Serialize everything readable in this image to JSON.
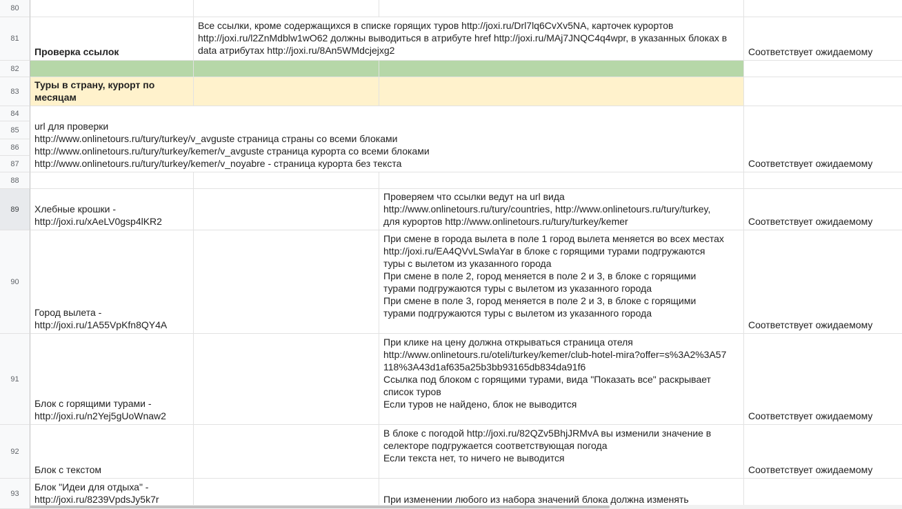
{
  "rows": [
    {
      "n": "80"
    },
    {
      "n": "81"
    },
    {
      "n": "82"
    },
    {
      "n": "83"
    },
    {
      "n": "84"
    },
    {
      "n": "85"
    },
    {
      "n": "86"
    },
    {
      "n": "87"
    },
    {
      "n": "88"
    },
    {
      "n": "89"
    },
    {
      "n": "90"
    },
    {
      "n": "91"
    },
    {
      "n": "92"
    },
    {
      "n": "93"
    }
  ],
  "r81": {
    "a": "Проверка ссылок",
    "b": "Все ссылки, кроме содержащихся в списке горящих туров http://joxi.ru/Drl7lq6CvXv5NA, карточек курортов http://joxi.ru/l2ZnMdblw1wO62 должны выводиться в атрибуте href http://joxi.ru/MAj7JNQC4q4wpr, в указанных блоках в data атрибутах http://joxi.ru/8An5WMdcjejxg2",
    "d": "Соответствует ожидаемому"
  },
  "r83": {
    "a": "Туры в страну, курорт по месяцам"
  },
  "r84_87": {
    "a": "url для проверки\nhttp://www.onlinetours.ru/tury/turkey/v_avguste страница страны со всеми блоками\nhttp://www.onlinetours.ru/tury/turkey/kemer/v_avguste страница курорта со всеми блоками\nhttp://www.onlinetours.ru/tury/turkey/kemer/v_noyabre - страница курорта без текста",
    "d": "Соответствует ожидаемому"
  },
  "r89": {
    "a": "Хлебные крошки -\nhttp://joxi.ru/xAeLV0gsp4lKR2",
    "c": "Проверяем что ссылки ведут на url вида\nhttp://www.onlinetours.ru/tury/countries, http://www.onlinetours.ru/tury/turkey,\nдля курортов http://www.onlinetours.ru/tury/turkey/kemer",
    "d": "Соответствует ожидаемому"
  },
  "r90": {
    "a": "Город вылета -\nhttp://joxi.ru/1A55VpKfn8QY4A",
    "c": "При смене в города вылета в поле 1 город вылета меняется во всех местах\nhttp://joxi.ru/EA4QVvLSwlaYar в блоке с горящими турами подгружаются\nтуры с вылетом из указанного города\nПри смене в поле 2, город меняется в поле 2 и 3, в блоке с горящими\nтурами подгружаются туры с вылетом из указанного города\nПри смене в поле 3, город меняется в поле 2 и 3, в блоке с горящими\nтурами подгружаются туры с вылетом из указанного города",
    "d": "Соответствует ожидаемому"
  },
  "r91": {
    "a": "Блок с горящими турами -\nhttp://joxi.ru/n2Yej5gUoWnaw2",
    "c": "При клике на цену должна открываться страница отеля\nhttp://www.onlinetours.ru/oteli/turkey/kemer/club-hotel-mira?offer=s%3A2%3A57\n118%3A43d1af635a25b3bb93165db834da91f6\nСсылка под блоком с горящими турами, вида \"Показать все\" раскрывает\nсписок туров\nЕсли туров не найдено, блок не выводится",
    "d": "Соответствует ожидаемому"
  },
  "r92": {
    "a": "Блок с текстом",
    "c": "В блоке с погодой http://joxi.ru/82QZv5BhjJRMvA вы изменили значение в\nселекторе подгружается соответствующая погода\nЕсли текста нет, то ничего не выводится",
    "d": "Соответствует ожидаемому"
  },
  "r93": {
    "a": " Блок \"Идеи для отдыха\" -\nhttp://joxi.ru/8239VpdsJy5k7r",
    "c": "При изменении любого из набора значений блока должна изменять"
  }
}
